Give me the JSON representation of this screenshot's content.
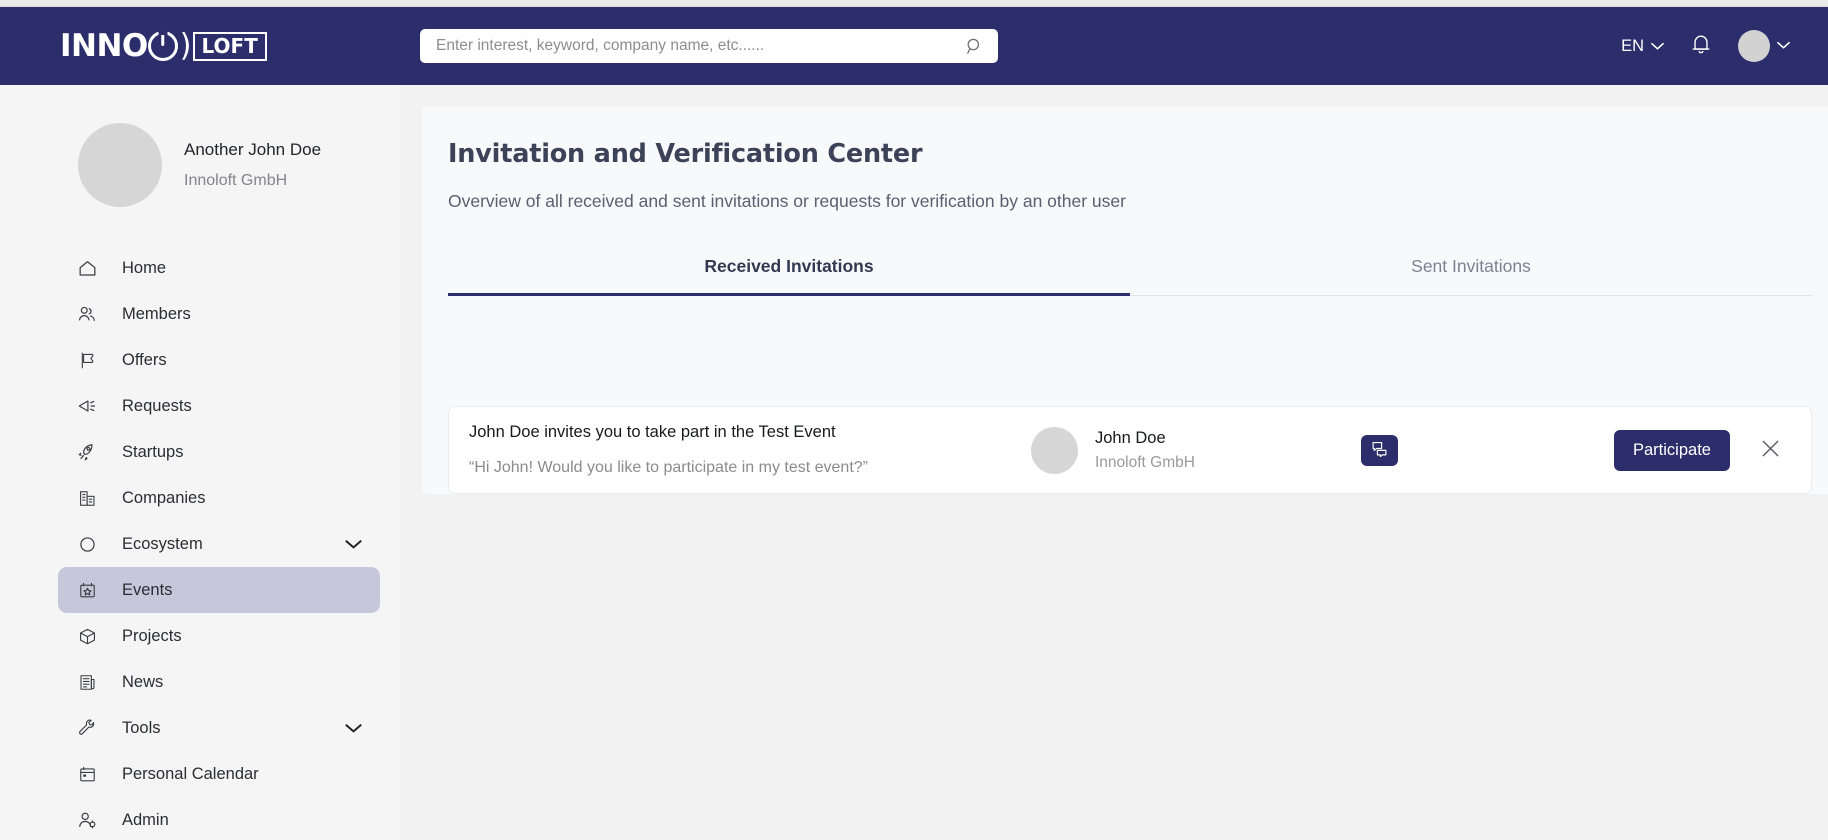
{
  "header": {
    "logo": {
      "word_main": "INNO",
      "word_badge": "LOFT",
      "paren": ")"
    },
    "search": {
      "placeholder": "Enter interest, keyword, company name, etc......",
      "value": "",
      "icon": "search-icon"
    },
    "language": {
      "label": "EN",
      "chevron": "chevron-down-icon"
    },
    "notifications_icon": "bell-icon",
    "account": {
      "avatar": "avatar",
      "chevron": "chevron-down-icon"
    },
    "background_color": "#2b2e6b"
  },
  "sidebar": {
    "profile": {
      "name": "Another John Doe",
      "company": "Innoloft GmbH"
    },
    "items": [
      {
        "label": "Home",
        "icon": "home-icon",
        "active": false,
        "expandable": false
      },
      {
        "label": "Members",
        "icon": "members-icon",
        "active": false,
        "expandable": false
      },
      {
        "label": "Offers",
        "icon": "offers-tag-icon",
        "active": false,
        "expandable": false
      },
      {
        "label": "Requests",
        "icon": "megaphone-icon",
        "active": false,
        "expandable": false
      },
      {
        "label": "Startups",
        "icon": "rocket-icon",
        "active": false,
        "expandable": false
      },
      {
        "label": "Companies",
        "icon": "building-icon",
        "active": false,
        "expandable": false
      },
      {
        "label": "Ecosystem",
        "icon": "circle-icon",
        "active": false,
        "expandable": true
      },
      {
        "label": "Events",
        "icon": "calendar-star-icon",
        "active": true,
        "expandable": false
      },
      {
        "label": "Projects",
        "icon": "cube-icon",
        "active": false,
        "expandable": false
      },
      {
        "label": "News",
        "icon": "newspaper-icon",
        "active": false,
        "expandable": false
      },
      {
        "label": "Tools",
        "icon": "wrench-icon",
        "active": false,
        "expandable": true
      },
      {
        "label": "Personal Calendar",
        "icon": "calendar-icon",
        "active": false,
        "expandable": false
      },
      {
        "label": "Admin",
        "icon": "user-gear-icon",
        "active": false,
        "expandable": false
      }
    ],
    "active_highlight_color": "#c6c7da"
  },
  "main": {
    "title": "Invitation and Verification Center",
    "subtitle": "Overview of all received and sent invitations or requests for verification by an other user",
    "tabs": [
      {
        "label": "Received Invitations",
        "active": true
      },
      {
        "label": "Sent Invitations",
        "active": false
      }
    ],
    "active_tab_color": "#2b2e6b",
    "invitations": [
      {
        "title": "John Doe invites you to take part in the Test Event",
        "message": "“Hi John! Would you like to participate in my test event?”",
        "sender_name": "John Doe",
        "sender_company": "Innoloft GmbH",
        "chat_icon": "chat-bubbles-icon",
        "primary_action": "Participate",
        "dismiss_icon": "close-icon"
      }
    ]
  }
}
